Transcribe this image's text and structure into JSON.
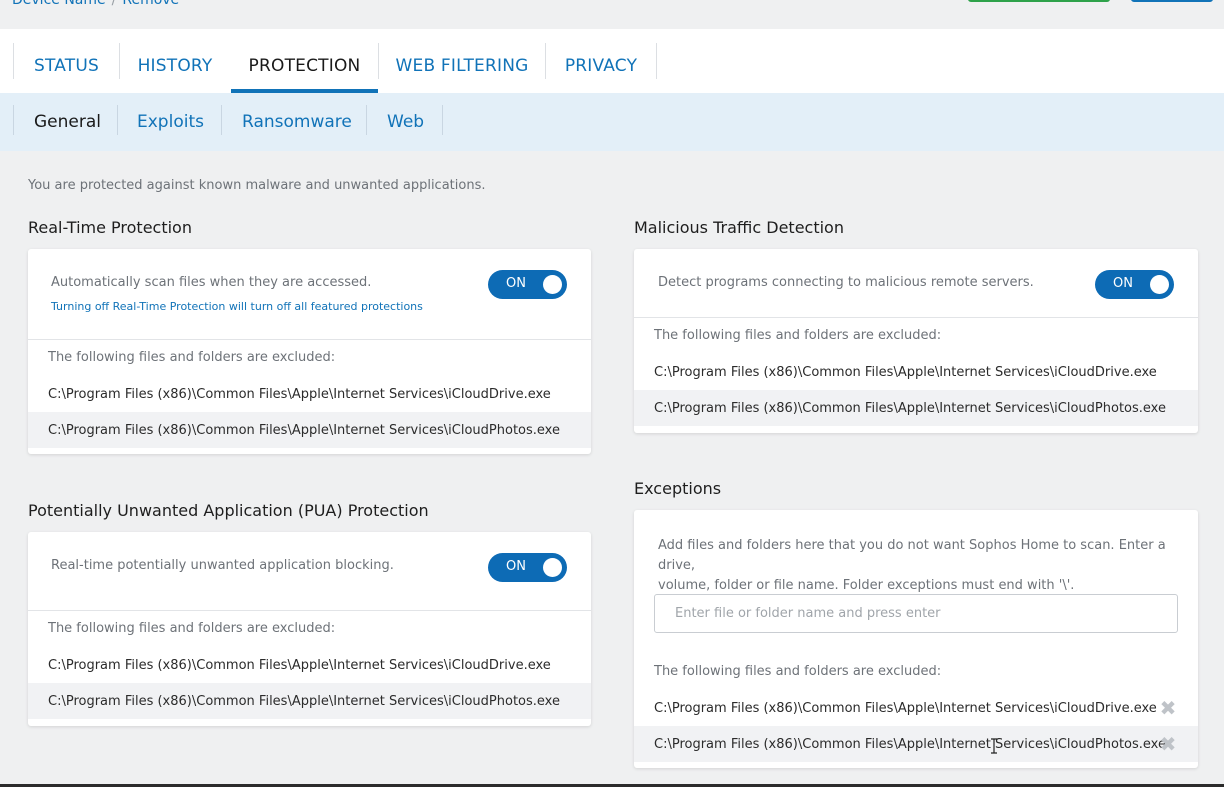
{
  "breadcrumb": {
    "device": "Device Name",
    "action": "Remove"
  },
  "main_tabs": [
    {
      "label": "STATUS"
    },
    {
      "label": "HISTORY"
    },
    {
      "label": "PROTECTION"
    },
    {
      "label": "WEB FILTERING"
    },
    {
      "label": "PRIVACY"
    }
  ],
  "sub_tabs": [
    {
      "label": "General"
    },
    {
      "label": "Exploits"
    },
    {
      "label": "Ransomware"
    },
    {
      "label": "Web"
    }
  ],
  "intro": "You are protected against known malware and unwanted applications.",
  "realtime": {
    "title": "Real-Time Protection",
    "desc": "Automatically scan files when they are accessed.",
    "warning": "Turning off Real-Time Protection will turn off all featured protections",
    "toggle": "ON",
    "excluded_label": "The following files and folders are excluded:",
    "files": [
      "C:\\Program Files (x86)\\Common Files\\Apple\\Internet Services\\iCloudDrive.exe",
      "C:\\Program Files (x86)\\Common Files\\Apple\\Internet Services\\iCloudPhotos.exe"
    ]
  },
  "pua": {
    "title": "Potentially Unwanted Application (PUA) Protection",
    "desc": "Real-time potentially unwanted application blocking.",
    "toggle": "ON",
    "excluded_label": "The following files and folders are excluded:",
    "files": [
      "C:\\Program Files (x86)\\Common Files\\Apple\\Internet Services\\iCloudDrive.exe",
      "C:\\Program Files (x86)\\Common Files\\Apple\\Internet Services\\iCloudPhotos.exe"
    ]
  },
  "traffic": {
    "title": "Malicious Traffic Detection",
    "desc": "Detect programs connecting to malicious remote servers.",
    "toggle": "ON",
    "excluded_label": "The following files and folders are excluded:",
    "files": [
      "C:\\Program Files (x86)\\Common Files\\Apple\\Internet Services\\iCloudDrive.exe",
      "C:\\Program Files (x86)\\Common Files\\Apple\\Internet Services\\iCloudPhotos.exe"
    ]
  },
  "exceptions": {
    "title": "Exceptions",
    "desc_line1": "Add files and folders here that you do not want Sophos Home to scan. Enter a drive,",
    "desc_line2": "volume, folder or file name. Folder exceptions must end with '\\'.",
    "input_placeholder": "Enter file or folder name and press enter",
    "excluded_label": "The following files and folders are excluded:",
    "files": [
      "C:\\Program Files (x86)\\Common Files\\Apple\\Internet Services\\iCloudDrive.exe",
      "C:\\Program Files (x86)\\Common Files\\Apple\\Internet Services\\iCloudPhotos.exe"
    ]
  },
  "colors": {
    "accent": "#1173b8",
    "toggle_on": "#0d6bb5",
    "subtab_bg": "#e3eff8",
    "page_bg": "#eff0f1"
  }
}
